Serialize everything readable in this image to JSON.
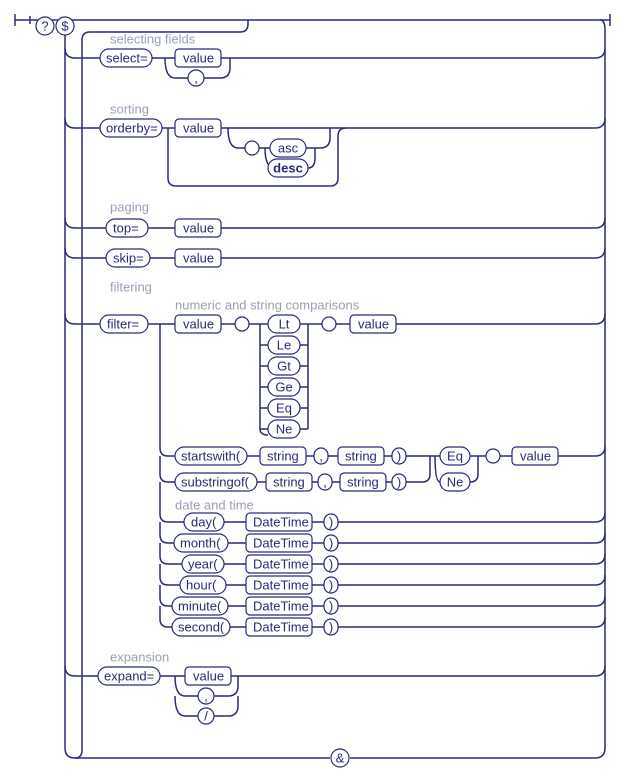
{
  "top": {
    "q": "?",
    "d": "$"
  },
  "sections": {
    "selecting": {
      "heading": "selecting fields",
      "select": "select=",
      "value": "value",
      "comma": ","
    },
    "sorting": {
      "heading": "sorting",
      "orderby": "orderby=",
      "value": "value",
      "asc": "asc",
      "desc": "desc"
    },
    "paging": {
      "heading": "paging",
      "top": "top=",
      "skip": "skip=",
      "value1": "value",
      "value2": "value"
    },
    "filtering": {
      "heading": "filtering",
      "subheading": "numeric and string comparisons",
      "filter": "filter=",
      "value1": "value",
      "value2": "value",
      "ops": {
        "lt": "Lt",
        "le": "Le",
        "gt": "Gt",
        "ge": "Ge",
        "eq": "Eq",
        "ne": "Ne"
      },
      "startswith": "startswith(",
      "substringof": "substringof(",
      "string1": "string",
      "string2": "string",
      "string3": "string",
      "string4": "string",
      "comma1": ",",
      "comma2": ",",
      "close1": ")",
      "close2": ")",
      "trail_eq": "Eq",
      "trail_ne": "Ne",
      "trail_value": "value",
      "dt_heading": "date and time",
      "dt": {
        "day": "day(",
        "month": "month(",
        "year": "year(",
        "hour": "hour(",
        "minute": "minute(",
        "second": "second("
      },
      "dt_val": {
        "day": "DateTime",
        "month": "DateTime",
        "year": "DateTime",
        "hour": "DateTime",
        "minute": "DateTime",
        "second": "DateTime"
      },
      "dt_close": {
        "day": ")",
        "month": ")",
        "year": ")",
        "hour": ")",
        "minute": ")",
        "second": ")"
      }
    },
    "expansion": {
      "heading": "expansion",
      "expand": "expand=",
      "value": "value",
      "comma": ",",
      "slash": "/"
    }
  },
  "bottom": {
    "amp": "&"
  }
}
